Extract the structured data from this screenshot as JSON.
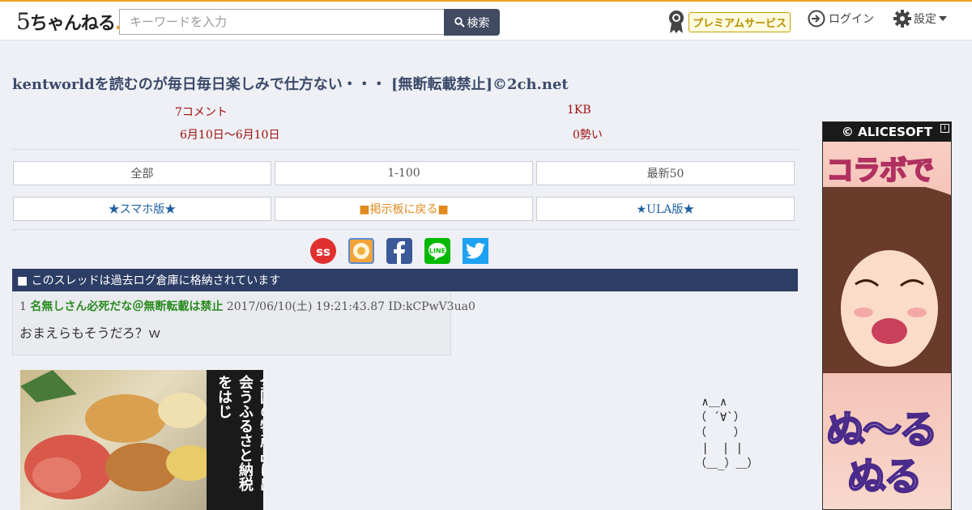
{
  "header": {
    "logo_text": "5ちゃんねる",
    "search_placeholder": "キーワードを入力",
    "search_button": "検索",
    "premium_label": "プレミアムサービス",
    "login_label": "ログイン",
    "settings_label": "設定"
  },
  "thread": {
    "title": "kentworldを読むのが毎日毎日楽しみで仕方ない・・・ [無断転載禁止]©2ch.net",
    "comments": "7コメント",
    "size": "1KB",
    "date_range": "6月10日〜6月10日",
    "momentum": "0勢い"
  },
  "nav": {
    "row1": [
      "全部",
      "1-100",
      "最新50"
    ],
    "row2": [
      "★スマホ版★",
      "■掲示板に戻る■",
      "★ULA版★"
    ]
  },
  "share_icons": [
    "ss-icon",
    "app-icon",
    "facebook-icon",
    "line-icon",
    "twitter-icon"
  ],
  "archive_notice": "■ このスレッドは過去ログ倉庫に格納されています",
  "posts": [
    {
      "num": "1",
      "name": "名無しさん必死だな＠無断転載は禁止",
      "date": "2017/06/10(土) 19:21:43.87",
      "id": "ID:kCPwV3ua0",
      "body": "おまえらもそうだろ？ｗ"
    }
  ],
  "ads": {
    "left_text": "全国の特産品に出会うふるさと納税をはじ",
    "right_brand": "© ALICESOFT",
    "right_line1": "コラボで",
    "right_line2": "ぬ〜る",
    "right_line3": "ぬる"
  },
  "ascii_art": " ∧＿∧\n（ ´∀`）\n（    ）\n |  | |\n（＿_）＿）"
}
